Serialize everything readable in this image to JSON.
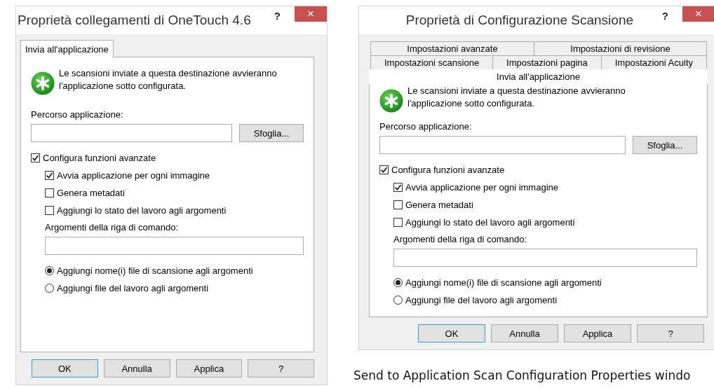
{
  "dialogs": [
    {
      "title": "Proprietà collegamenti di OneTouch 4.6",
      "help": "?",
      "close": "×",
      "tab_rows": [
        [
          {
            "label": "Invia all'applicazione",
            "selected": true
          }
        ]
      ],
      "description": "Le scansioni inviate a questa destinazione avvieranno l'applicazione sotto configurata.",
      "path_label": "Percorso applicazione:",
      "browse_button": "Sfoglia...",
      "options": [
        {
          "label": "Configura funzioni avanzate",
          "checked": true,
          "children": [
            {
              "label": "Avvia applicazione per ogni immagine",
              "checked": true
            },
            {
              "label": "Genera metadati",
              "checked": false
            },
            {
              "label": "Aggiungi lo stato del lavoro agli argomenti",
              "checked": false
            }
          ]
        }
      ],
      "args_label": "Argomenti della riga di comando:",
      "radios": [
        {
          "label": "Aggiungi nome(i) file di scansione agli argomenti",
          "selected": true
        },
        {
          "label": "Aggiungi file del lavoro agli argomenti",
          "selected": false
        }
      ],
      "buttons": [
        {
          "label": "OK",
          "default": true
        },
        {
          "label": "Annulla",
          "default": false
        },
        {
          "label": "Applica",
          "default": false
        },
        {
          "label": "?",
          "default": false
        }
      ]
    },
    {
      "title": "Proprietà di Configurazione Scansione",
      "help": "?",
      "close": "×",
      "tab_rows": [
        [
          {
            "label": "Impostazioni avanzate",
            "selected": false
          },
          {
            "label": "Impostazioni di revisione",
            "selected": false
          }
        ],
        [
          {
            "label": "Impostazioni scansione",
            "selected": false
          },
          {
            "label": "Impostazioni pagina",
            "selected": false
          },
          {
            "label": "Impostazioni Acuity",
            "selected": false
          }
        ],
        [
          {
            "label": "Invia all'applicazione",
            "selected": true
          }
        ]
      ],
      "description": "Le scansioni inviate a questa destinazione avvieranno l'applicazione sotto configurata.",
      "path_label": "Percorso applicazione:",
      "browse_button": "Sfoglia...",
      "options": [
        {
          "label": "Configura funzioni avanzate",
          "checked": true,
          "children": [
            {
              "label": "Avvia applicazione per ogni immagine",
              "checked": true
            },
            {
              "label": "Genera metadati",
              "checked": false
            },
            {
              "label": "Aggiungi lo stato del lavoro agli argomenti",
              "checked": false
            }
          ]
        }
      ],
      "args_label": "Argomenti della riga di comando:",
      "radios": [
        {
          "label": "Aggiungi nome(i) file di scansione agli argomenti",
          "selected": true
        },
        {
          "label": "Aggiungi file del lavoro agli argomenti",
          "selected": false
        }
      ],
      "buttons": [
        {
          "label": "OK",
          "default": true
        },
        {
          "label": "Annulla",
          "default": false
        },
        {
          "label": "Applica",
          "default": false
        },
        {
          "label": "?",
          "default": false
        }
      ]
    }
  ],
  "caption": "Send to Application Scan Configuration Properties windo"
}
